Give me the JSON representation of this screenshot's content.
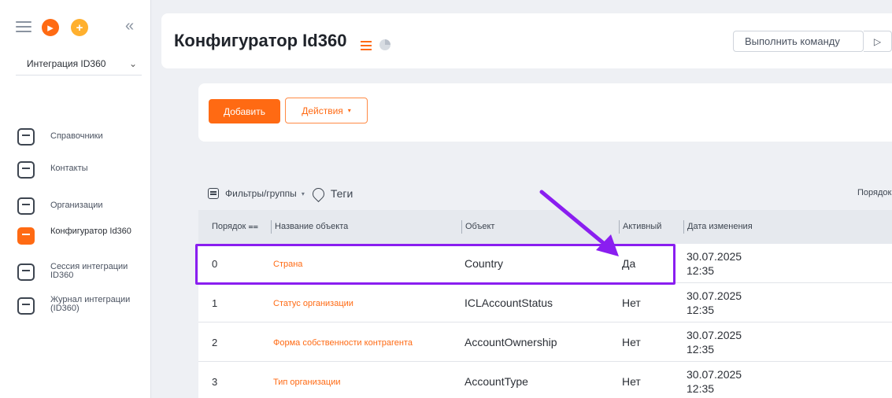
{
  "sidebar": {
    "workspace": "Интеграция ID360",
    "items": [
      {
        "label": "Справочники",
        "active": false
      },
      {
        "label": "Контакты",
        "active": false
      },
      {
        "label": "Организации",
        "active": false
      },
      {
        "label": "Конфигуратор Id360",
        "active": true
      },
      {
        "label": "Сессия интеграции ID360",
        "active": false
      },
      {
        "label": "Журнал интеграции (ID360)",
        "active": false
      }
    ]
  },
  "header": {
    "title": "Конфигуратор Id360",
    "command_button": "Выполнить команду"
  },
  "toolbar": {
    "add_label": "Добавить",
    "actions_label": "Действия"
  },
  "filters": {
    "filters_label": "Фильтры/группы",
    "tags_label": "Теги",
    "sort_label": "Порядок"
  },
  "table": {
    "columns": [
      "Порядок",
      "Название объекта",
      "Объект",
      "Активный",
      "Дата изменения"
    ],
    "rows": [
      {
        "order": "0",
        "name": "Страна",
        "object": "Country",
        "active": "Да",
        "date": "30.07.2025 12:35"
      },
      {
        "order": "1",
        "name": "Статус организации",
        "object": "ICLAccountStatus",
        "active": "Нет",
        "date": "30.07.2025 12:35"
      },
      {
        "order": "2",
        "name": "Форма собственности контрагента",
        "object": "AccountOwnership",
        "active": "Нет",
        "date": "30.07.2025 12:35"
      },
      {
        "order": "3",
        "name": "Тип организации",
        "object": "AccountType",
        "active": "Нет",
        "date": "30.07.2025 12:35"
      }
    ]
  },
  "colors": {
    "accent": "#ff6a13",
    "annotation": "#8a1ef0"
  }
}
